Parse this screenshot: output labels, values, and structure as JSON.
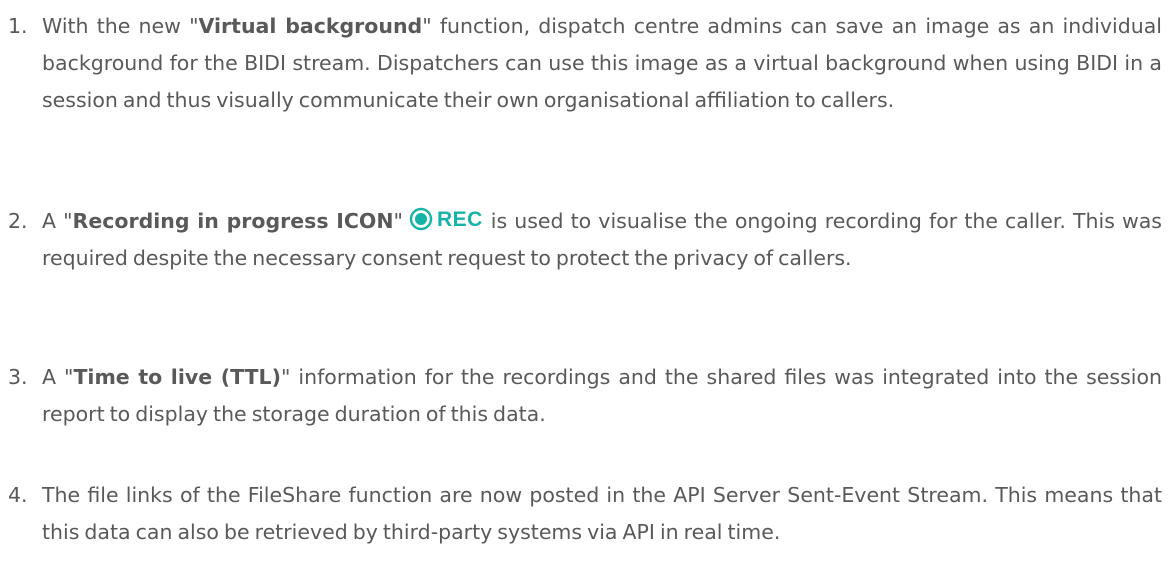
{
  "items": [
    {
      "number": "1.",
      "before": "With the new \"",
      "bold": "Virtual background",
      "after": "\" function, dispatch centre admins can save an image as an individual background for the BIDI stream. Dispatchers can use this image as a virtual background when using BIDI in a session and thus visually communicate their own organisational affiliation to callers."
    },
    {
      "number": "2.",
      "before": "A \"",
      "bold": "Recording in progress ICON",
      "middle": "\"",
      "icon": {
        "name": "record-icon",
        "label": "REC",
        "color": "#16b3a8"
      },
      "after": "is used to visualise the ongoing recording for the caller. This was required despite the necessary consent request to protect the privacy of callers."
    },
    {
      "number": "3.",
      "before": "A \"",
      "bold": "Time to live (TTL)",
      "after": "\" information for the recordings and the shared files was integrated into the session report to display the storage duration of this data."
    },
    {
      "number": "4.",
      "text": "The file links of the FileShare function are now posted in the API Server Sent-Event Stream. This means that this data can also be retrieved by third-party systems via API in real time."
    }
  ]
}
